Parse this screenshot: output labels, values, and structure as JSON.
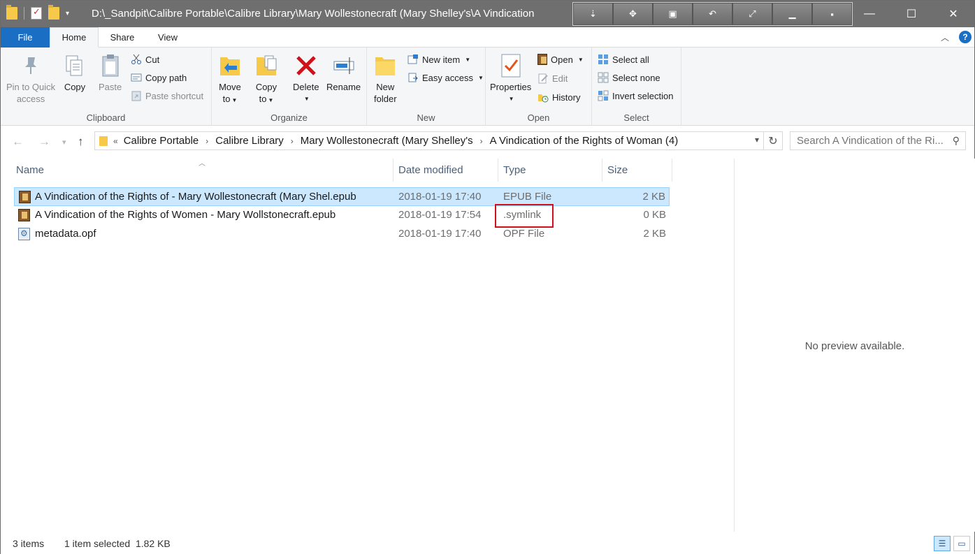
{
  "window": {
    "title": "D:\\_Sandpit\\Calibre Portable\\Calibre Library\\Mary Wollestonecraft (Mary Shelley's\\A Vindication",
    "controls": {
      "minimize": "—",
      "maximize": "☐",
      "close": "✕"
    },
    "extra_buttons": [
      "⇣",
      "✥",
      "▣",
      "↶",
      "⤢",
      "▁",
      "▪"
    ]
  },
  "tabs": {
    "file": "File",
    "home": "Home",
    "share": "Share",
    "view": "View",
    "help": "?"
  },
  "ribbon": {
    "clipboard": {
      "label": "Clipboard",
      "pin_line1": "Pin to Quick",
      "pin_line2": "access",
      "copy": "Copy",
      "paste": "Paste",
      "cut": "Cut",
      "copy_path": "Copy path",
      "paste_shortcut": "Paste shortcut"
    },
    "organize": {
      "label": "Organize",
      "move_line1": "Move",
      "move_line2": "to",
      "copy_line1": "Copy",
      "copy_line2": "to",
      "delete": "Delete",
      "rename": "Rename"
    },
    "new": {
      "label": "New",
      "new_folder_line1": "New",
      "new_folder_line2": "folder",
      "new_item": "New item",
      "easy_access": "Easy access"
    },
    "open": {
      "label": "Open",
      "properties": "Properties",
      "open": "Open",
      "edit": "Edit",
      "history": "History"
    },
    "select": {
      "label": "Select",
      "select_all": "Select all",
      "select_none": "Select none",
      "invert": "Invert selection"
    }
  },
  "address": {
    "overflow": "«",
    "crumbs": [
      "Calibre Portable",
      "Calibre Library",
      "Mary Wollestonecraft (Mary Shelley's",
      "A Vindication of the Rights of Woman (4)"
    ],
    "search_placeholder": "Search A Vindication of the Ri..."
  },
  "columns": {
    "name": "Name",
    "date": "Date modified",
    "type": "Type",
    "size": "Size"
  },
  "files": [
    {
      "name": "A Vindication of the Rights of - Mary Wollestonecraft (Mary Shel.epub",
      "date": "2018-01-19 17:40",
      "type": "EPUB File",
      "size": "2 KB",
      "icon": "book-icon",
      "selected": true
    },
    {
      "name": "A Vindication of the Rights of Women - Mary Wollstonecraft.epub",
      "date": "2018-01-19 17:54",
      "type": ".symlink",
      "size": "0 KB",
      "icon": "book-icon",
      "selected": false
    },
    {
      "name": "metadata.opf",
      "date": "2018-01-19 17:40",
      "type": "OPF File",
      "size": "2 KB",
      "icon": "opf-file-icon",
      "selected": false
    }
  ],
  "preview": {
    "text": "No preview available."
  },
  "status": {
    "items": "3 items",
    "selection": "1 item selected  1.82 KB"
  },
  "colors": {
    "accent": "#1a6fc4",
    "selection": "#cce8ff",
    "highlight": "#d0101a",
    "titlebar": "#6f6f6f"
  }
}
